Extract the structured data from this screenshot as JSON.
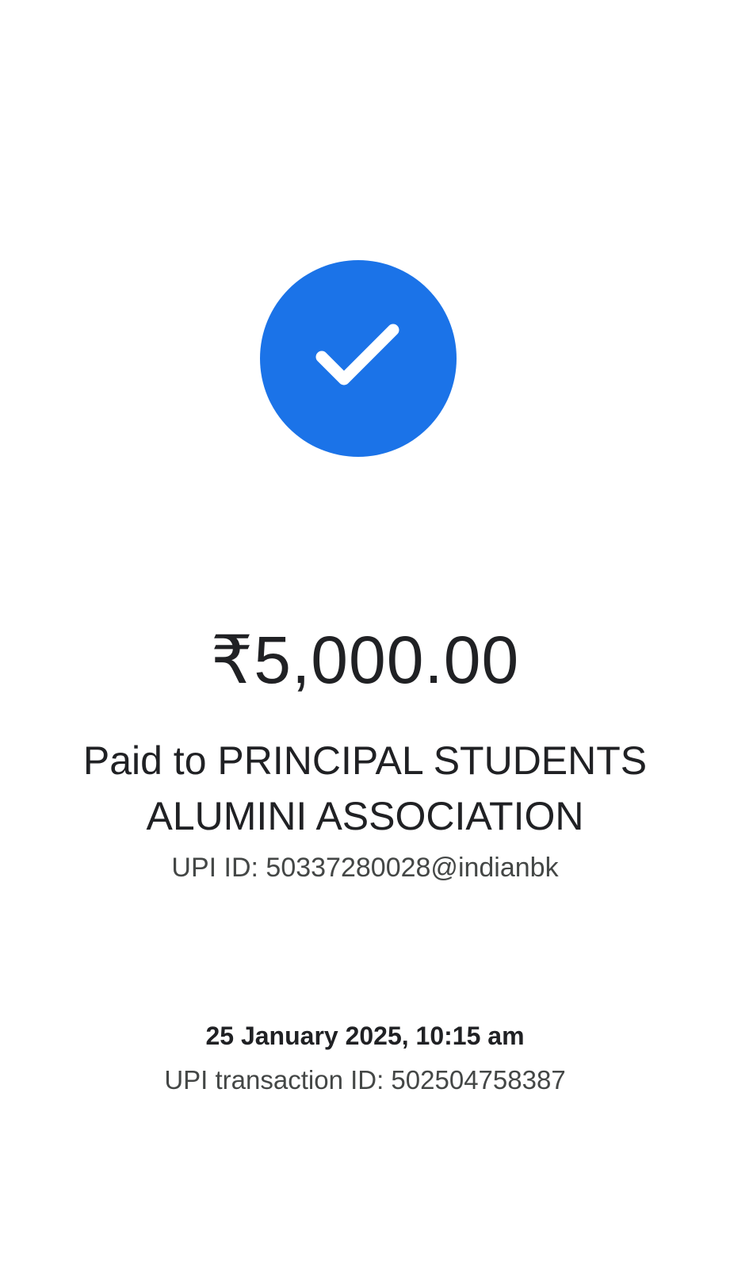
{
  "status": {
    "icon": "checkmark-icon",
    "color": "#1b73e8"
  },
  "payment": {
    "amount": "₹5,000.00",
    "payee": "Paid to PRINCIPAL STUDENTS ALUMINI ASSOCIATION",
    "upi_id": "UPI ID: 50337280028@indianbk",
    "datetime": "25 January 2025, 10:15 am",
    "transaction_id": "UPI transaction ID: 502504758387"
  }
}
